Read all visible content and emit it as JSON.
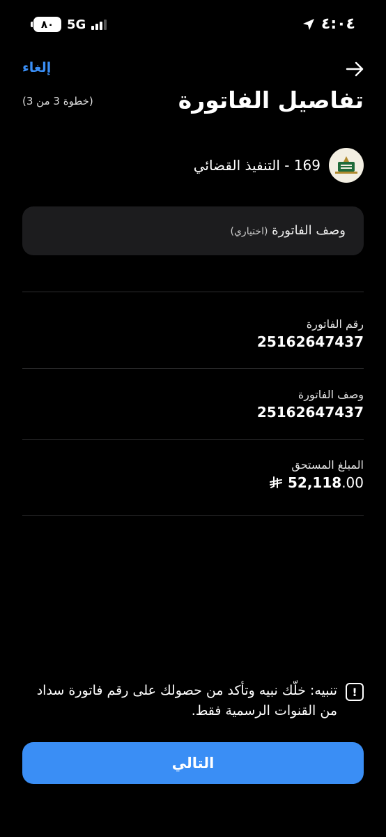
{
  "status_bar": {
    "battery": "٨٠",
    "network": "5G",
    "time": "٤:٠٤"
  },
  "nav": {
    "cancel_label": "إلغاء",
    "back_icon": "arrow-right-icon"
  },
  "header": {
    "title": "تفاصيل الفاتورة",
    "step": "(خطوة 3 من 3)"
  },
  "biller": {
    "name": "169 - التنفيذ القضائي",
    "logo_icon": "ministry-logo-icon"
  },
  "description_input": {
    "placeholder_main": "وصف الفاتورة",
    "placeholder_optional": "(اختياري)",
    "value": ""
  },
  "fields": {
    "invoice_number": {
      "label": "رقم الفاتورة",
      "value": "25162647437"
    },
    "invoice_description": {
      "label": "وصف الفاتورة",
      "value": "25162647437"
    },
    "amount_due": {
      "label": "المبلغ المستحق",
      "integer": "52,118",
      "decimal": ".00",
      "currency_icon": "riyal-symbol-icon"
    }
  },
  "warning": {
    "text": "تنبيه: خلّك نبيه وتأكد من حصولك على رقم فاتورة سداد من القنوات الرسمية فقط.",
    "icon": "exclamation-icon"
  },
  "next_button": {
    "label": "التالي"
  },
  "colors": {
    "accent": "#3a8ef5",
    "background": "#000000",
    "input_bg": "#1c1c1e"
  }
}
